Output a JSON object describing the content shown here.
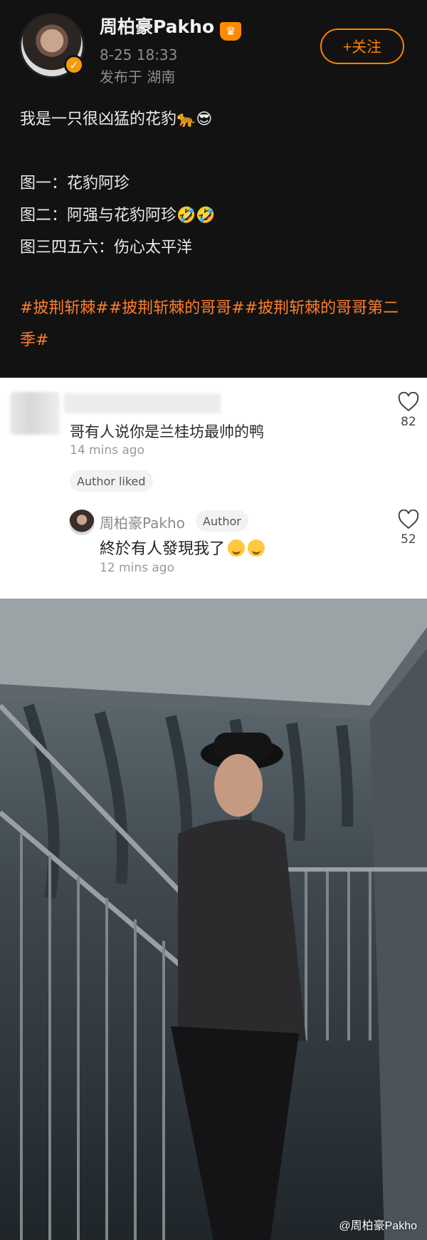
{
  "post": {
    "username": "周柏豪Pakho",
    "crown_icon": "crown-icon",
    "verified_icon": "verified-v-badge",
    "timestamp": "8-25 18:33",
    "location": "发布于 湖南",
    "follow_label": "+关注",
    "lines": [
      "我是一只很凶猛的花豹🐆😎",
      "",
      "图一：花豹阿珍",
      "图二：阿强与花豹阿珍🤣🤣",
      "图三四五六：伤心太平洋"
    ],
    "hashtags": "#披荆斩棘##披荆斩棘的哥哥##披荆斩棘的哥哥第二季#",
    "accent_color": "#ff8200"
  },
  "comment": {
    "text": "哥有人说你是兰桂坊最帅的鸭",
    "time": "14 mins ago",
    "badge": "Author liked",
    "likes": "82"
  },
  "reply": {
    "author": "周柏豪Pakho",
    "author_badge": "Author",
    "text": "終於有人發現我了",
    "time": "12 mins ago",
    "likes": "52"
  },
  "photo": {
    "watermark": "@周柏豪Pakho"
  }
}
